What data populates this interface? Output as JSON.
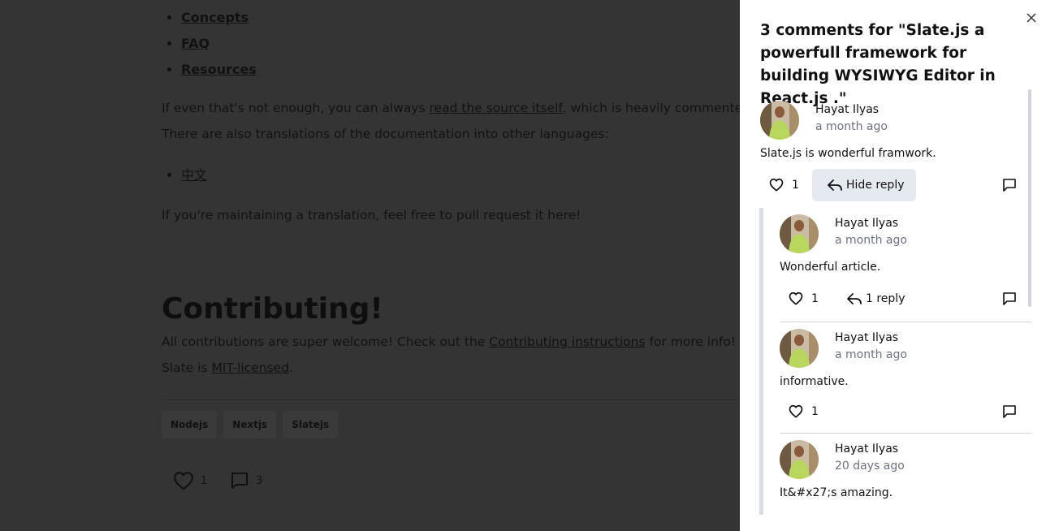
{
  "article": {
    "bullets": [
      "Concepts",
      "FAQ",
      "Resources"
    ],
    "para1_before": "If even that's not enough, you can always ",
    "para1_link": "read the source itself",
    "para1_after": ", which is heavily commented.",
    "para2": "There are also translations of the documentation into other languages:",
    "translations": [
      "中文"
    ],
    "para3": "If you're maintaining a translation, feel free to pull request it here!",
    "heading": "Contributing!",
    "para4_before": "All contributions are super welcome! Check out the ",
    "para4_link": "Contributing instructions",
    "para4_after": " for more info!",
    "para5_before": "Slate is ",
    "para5_link": "MIT-licensed",
    "para5_after": ".",
    "tags": [
      "Nodejs",
      "Nextjs",
      "Slatejs"
    ],
    "likes": "1",
    "comments": "3"
  },
  "panel": {
    "title": "3 comments for \"Slate.js a powerfull framework for building WYSIWYG Editor in React.js .\"",
    "comments": [
      {
        "name": "Hayat Ilyas",
        "time": "a month ago",
        "text": "Slate.js is wonderful framwork.",
        "likes": "1",
        "reply_label": "Hide reply"
      },
      {
        "name": "Hayat Ilyas",
        "time": "a month ago",
        "text": "Wonderful article.",
        "likes": "1",
        "reply_label": "1 reply"
      },
      {
        "name": "Hayat Ilyas",
        "time": "a month ago",
        "text": "informative.",
        "likes": "1"
      },
      {
        "name": "Hayat Ilyas",
        "time": "20 days ago",
        "text": "It&#x27;s amazing."
      }
    ]
  },
  "colors": {
    "overlay_bg": "#343434",
    "panel_bg": "#ffffff",
    "muted_text": "#6b7280",
    "active_button_bg": "#e5eaf0"
  }
}
